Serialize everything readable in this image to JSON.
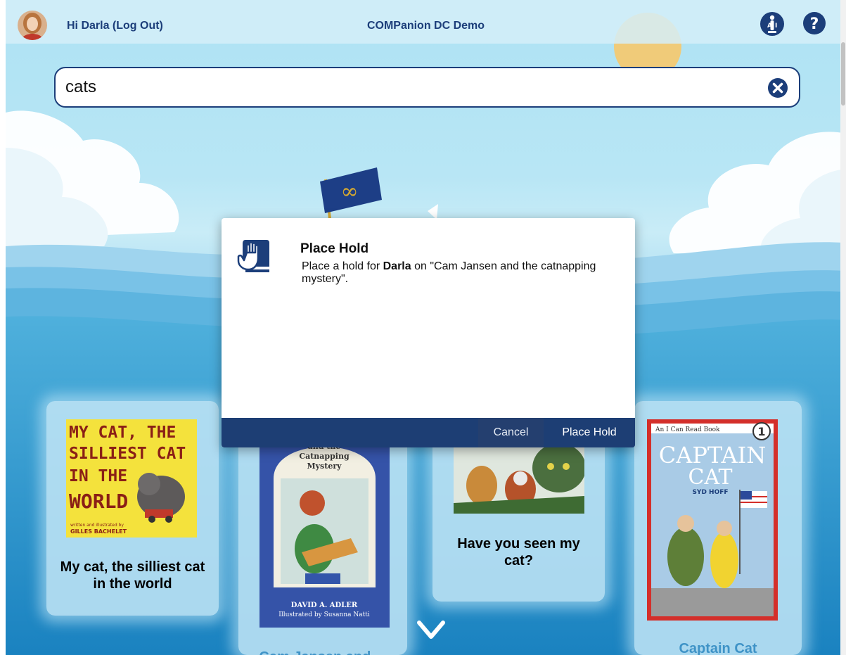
{
  "header": {
    "greeting": "Hi Darla (Log Out)",
    "site_title": "COMPanion DC Demo"
  },
  "search": {
    "value": "cats",
    "placeholder": ""
  },
  "books": [
    {
      "title": "My cat, the silliest cat in the world",
      "cover_text": [
        "MY CAT, THE",
        "SILLIEST CAT",
        "IN THE",
        "WORLD"
      ],
      "cover_credit": [
        "written and illustrated by",
        "GILLES BACHELET"
      ]
    },
    {
      "title": "Cam Jansen and ...",
      "cover_text": [
        "and the",
        "Catnapping",
        "Mystery"
      ],
      "cover_credit": [
        "DAVID A. ADLER",
        "Illustrated by Susanna Natti"
      ]
    },
    {
      "title": "Have you seen my cat?"
    },
    {
      "title": "Captain Cat",
      "cover_text": [
        "CAPTAIN",
        "CAT"
      ],
      "cover_series": "An I Can Read Book",
      "cover_author": "SYD HOFF",
      "cover_level": "1"
    }
  ],
  "dialog": {
    "title": "Place Hold",
    "message_prefix": "Place a hold for ",
    "patron_name": "Darla",
    "message_suffix": " on \"Cam Jansen and the catnapping mystery\".",
    "cancel_label": "Cancel",
    "confirm_label": "Place Hold"
  },
  "icons": {
    "settings": "settings-figure-icon",
    "help": "question-mark-icon",
    "clear": "clear-x-icon",
    "hold": "hand-on-book-icon",
    "more": "chevron-down-icon"
  },
  "colors": {
    "brand_navy": "#1c3e7a",
    "dialog_footer": "#1d3e74",
    "sky": "#aee2f3",
    "water": "#2e93c9"
  }
}
